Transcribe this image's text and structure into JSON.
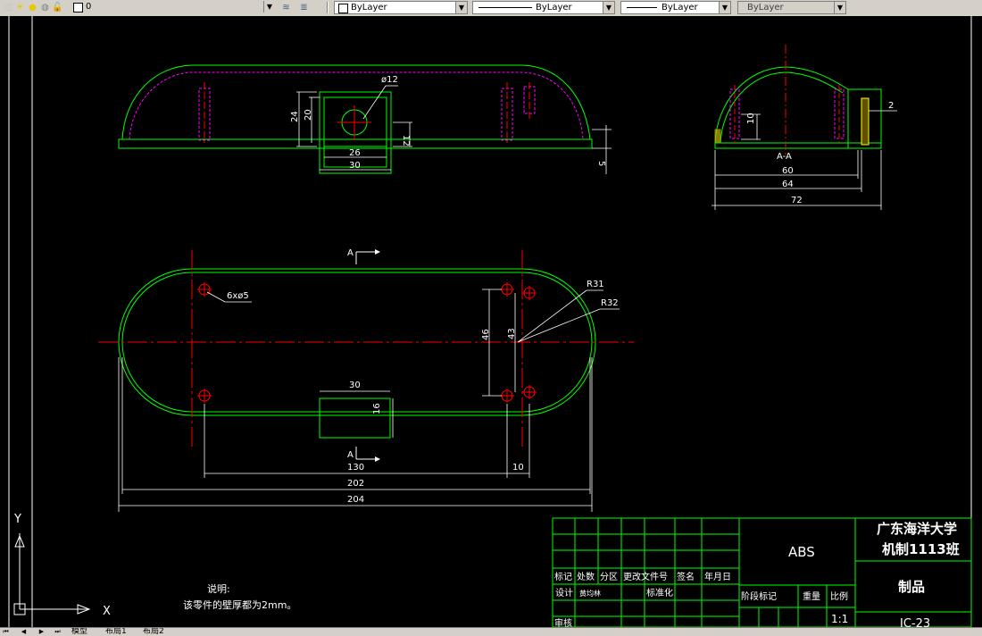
{
  "toolbar": {
    "layer_name": "0",
    "color_value": "ByLayer",
    "linetype_value": "ByLayer",
    "lineweight_value": "ByLayer",
    "plotstyle_value": "ByLayer"
  },
  "drawing": {
    "top_view": {
      "dim_phi12": "ø12",
      "dim_24": "24",
      "dim_20": "20",
      "dim_12": "12",
      "dim_26": "26",
      "dim_30": "30",
      "dim_5": "5"
    },
    "side_view": {
      "dim_10": "10",
      "dim_2": "2",
      "dim_60": "60",
      "dim_64": "64",
      "dim_72": "72",
      "section_label": "A-A"
    },
    "plan_view": {
      "section_mark_top": "A",
      "section_mark_bottom": "A",
      "hole_note": "6xø5",
      "dim_r31": "R31",
      "dim_r32": "R32",
      "dim_46": "46",
      "dim_43": "43",
      "dim_30": "30",
      "dim_16": "16",
      "dim_130": "130",
      "dim_10": "10",
      "dim_202": "202",
      "dim_204": "204"
    },
    "notes": {
      "title": "说明:",
      "text": "该零件的壁厚都为2mm。"
    },
    "ucs": {
      "x_label": "X",
      "y_label": "Y"
    }
  },
  "title_block": {
    "material": "ABS",
    "school": "广东海洋大学",
    "class_name": "机制1113班",
    "part_name": "制品",
    "drawing_no": "JC-23",
    "scale": "1:1",
    "headers": [
      "标记",
      "处数",
      "分区",
      "更改文件号",
      "签名",
      "年月日"
    ],
    "design_label": "设计",
    "designer": "黄均林",
    "standard_label": "标准化",
    "stage_label": "阶段标记",
    "weight_label": "重量",
    "scale_label": "比例",
    "review_label": "审核"
  },
  "layout_tabs": [
    "模型",
    "布局1",
    "布局2"
  ],
  "colors": {
    "background": "#000000",
    "outline": "#00ff00",
    "centerline": "#ff0000",
    "hidden": "#ff00ff",
    "dimension": "#ffffff",
    "hatch": "#ffff00"
  }
}
